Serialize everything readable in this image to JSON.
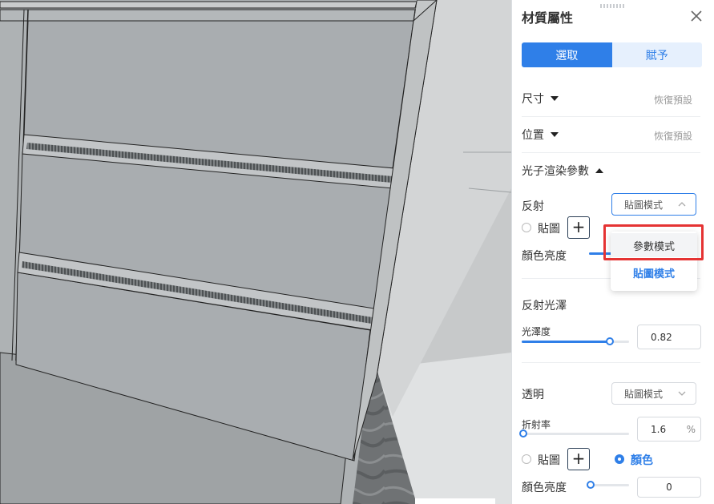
{
  "panel": {
    "title": "材質屬性",
    "tabs": {
      "select": "選取",
      "assign": "賦予"
    },
    "size": {
      "label": "尺寸",
      "reset": "恢復預設"
    },
    "position": {
      "label": "位置",
      "reset": "恢復預設"
    },
    "photon": {
      "label": "光子渲染參數"
    },
    "reflection": {
      "label": "反射",
      "mode": "貼圖模式",
      "radio_map": "貼圖",
      "brightness_label": "顏色亮度"
    },
    "gloss": {
      "section": "反射光澤",
      "label": "光澤度",
      "value": "0.82",
      "level": 0.82
    },
    "transparency": {
      "label": "透明",
      "mode": "貼圖模式",
      "refraction_label": "折射率",
      "refraction_value": "1.6",
      "refraction_unit": "%",
      "radio_map": "貼圖",
      "radio_color": "顏色",
      "brightness_label": "顏色亮度",
      "brightness_value": "0"
    }
  },
  "dropdown": {
    "options": [
      "參數模式",
      "貼圖模式"
    ],
    "selected": "貼圖模式"
  },
  "colors": {
    "accent": "#2f7fe8",
    "highlight": "#e53333"
  }
}
